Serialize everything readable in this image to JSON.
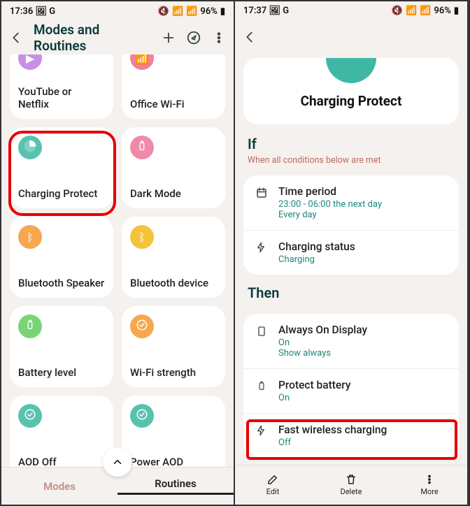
{
  "left": {
    "status_time": "17:36",
    "status_apps": "G",
    "status_pct": "96%",
    "title": "Modes and Routines",
    "cards": [
      {
        "label": "YouTube or Netflix",
        "color": "#c88fe8"
      },
      {
        "label": "Office Wi-Fi",
        "color": "#f07fa1"
      },
      {
        "label": "Charging Protect",
        "color": "#59c2af"
      },
      {
        "label": "Dark Mode",
        "color": "#f08aa9"
      },
      {
        "label": "Bluetooth Speaker",
        "color": "#f5a84e"
      },
      {
        "label": "Bluetooth device",
        "color": "#f4c33c"
      },
      {
        "label": "Battery level",
        "color": "#79d478"
      },
      {
        "label": "Wi-Fi strength",
        "color": "#f5a84e"
      },
      {
        "label": "AOD Off",
        "color": "#59c2af"
      },
      {
        "label": "Power AOD",
        "color": "#59c2af"
      }
    ],
    "tabs": {
      "modes": "Modes",
      "routines": "Routines"
    }
  },
  "right": {
    "status_time": "17:37",
    "status_apps": "G",
    "status_pct": "96%",
    "heading": "Charging Protect",
    "if_title": "If",
    "if_sub": "When all conditions below are met",
    "then_title": "Then",
    "if_rows": [
      {
        "t1": "Time period",
        "t2": "23:00 - 06:00 the next day",
        "t3": "Every day"
      },
      {
        "t1": "Charging status",
        "t2": "Charging"
      }
    ],
    "then_rows": [
      {
        "t1": "Always On Display",
        "t2": "On",
        "t3": "Show always"
      },
      {
        "t1": "Protect battery",
        "t2": "On"
      },
      {
        "t1": "Fast wireless charging",
        "t2": "Off"
      }
    ],
    "actions": {
      "edit": "Edit",
      "delete": "Delete",
      "more": "More"
    }
  }
}
